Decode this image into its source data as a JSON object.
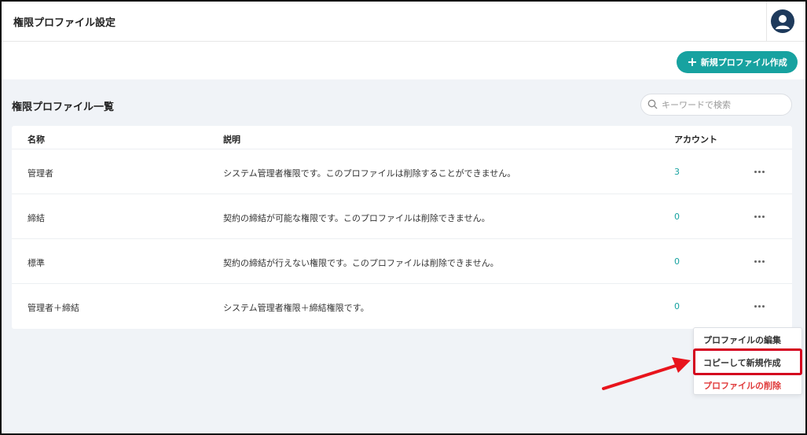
{
  "header": {
    "title": "権限プロファイル設定",
    "avatar_icon": "user-avatar-icon"
  },
  "actions": {
    "new_button_label": "新規プロファイル作成",
    "new_button_icon": "plus-icon",
    "accent_color": "#17a2a0"
  },
  "list": {
    "title": "権限プロファイル一覧",
    "search_placeholder": "キーワードで検索",
    "columns": {
      "name": "名称",
      "description": "説明",
      "accounts": "アカウント"
    },
    "rows": [
      {
        "name": "管理者",
        "description": "システム管理者権限です。このプロファイルは削除することができません。",
        "accounts": "3"
      },
      {
        "name": "締結",
        "description": "契約の締結が可能な権限です。このプロファイルは削除できません。",
        "accounts": "0"
      },
      {
        "name": "標準",
        "description": "契約の締結が行えない権限です。このプロファイルは削除できません。",
        "accounts": "0"
      },
      {
        "name": "管理者＋締結",
        "description": "システム管理者権限＋締結権限です。",
        "accounts": "0"
      }
    ]
  },
  "context_menu": {
    "edit": "プロファイルの編集",
    "copy_new": "コピーして新規作成",
    "delete": "プロファイルの削除",
    "danger_color": "#e03a3a",
    "highlight_color": "#d4001e"
  }
}
